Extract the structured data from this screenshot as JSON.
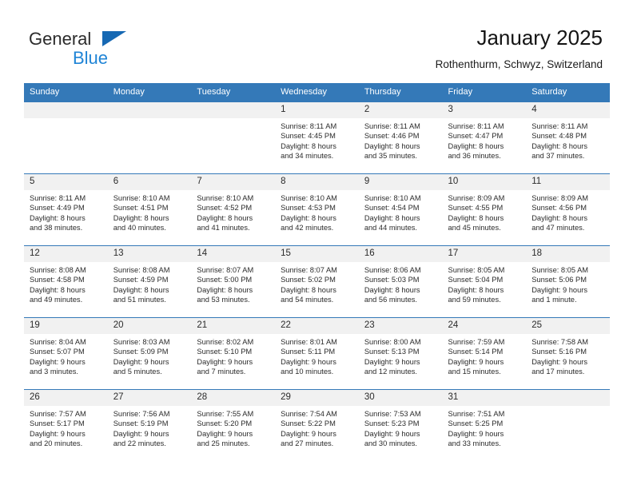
{
  "brand": {
    "name_part1": "General",
    "name_part2": "Blue",
    "accent_color": "#1668b3",
    "blue_text_color": "#1f84d6"
  },
  "header": {
    "title": "January 2025",
    "location": "Rothenthurm, Schwyz, Switzerland"
  },
  "calendar": {
    "header_bg": "#3479b8",
    "daynum_bg": "#f1f1f1",
    "weekday_labels": [
      "Sunday",
      "Monday",
      "Tuesday",
      "Wednesday",
      "Thursday",
      "Friday",
      "Saturday"
    ],
    "weeks": [
      [
        {
          "day": "",
          "lines": []
        },
        {
          "day": "",
          "lines": []
        },
        {
          "day": "",
          "lines": []
        },
        {
          "day": "1",
          "lines": [
            "Sunrise: 8:11 AM",
            "Sunset: 4:45 PM",
            "Daylight: 8 hours",
            "and 34 minutes."
          ]
        },
        {
          "day": "2",
          "lines": [
            "Sunrise: 8:11 AM",
            "Sunset: 4:46 PM",
            "Daylight: 8 hours",
            "and 35 minutes."
          ]
        },
        {
          "day": "3",
          "lines": [
            "Sunrise: 8:11 AM",
            "Sunset: 4:47 PM",
            "Daylight: 8 hours",
            "and 36 minutes."
          ]
        },
        {
          "day": "4",
          "lines": [
            "Sunrise: 8:11 AM",
            "Sunset: 4:48 PM",
            "Daylight: 8 hours",
            "and 37 minutes."
          ]
        }
      ],
      [
        {
          "day": "5",
          "lines": [
            "Sunrise: 8:11 AM",
            "Sunset: 4:49 PM",
            "Daylight: 8 hours",
            "and 38 minutes."
          ]
        },
        {
          "day": "6",
          "lines": [
            "Sunrise: 8:10 AM",
            "Sunset: 4:51 PM",
            "Daylight: 8 hours",
            "and 40 minutes."
          ]
        },
        {
          "day": "7",
          "lines": [
            "Sunrise: 8:10 AM",
            "Sunset: 4:52 PM",
            "Daylight: 8 hours",
            "and 41 minutes."
          ]
        },
        {
          "day": "8",
          "lines": [
            "Sunrise: 8:10 AM",
            "Sunset: 4:53 PM",
            "Daylight: 8 hours",
            "and 42 minutes."
          ]
        },
        {
          "day": "9",
          "lines": [
            "Sunrise: 8:10 AM",
            "Sunset: 4:54 PM",
            "Daylight: 8 hours",
            "and 44 minutes."
          ]
        },
        {
          "day": "10",
          "lines": [
            "Sunrise: 8:09 AM",
            "Sunset: 4:55 PM",
            "Daylight: 8 hours",
            "and 45 minutes."
          ]
        },
        {
          "day": "11",
          "lines": [
            "Sunrise: 8:09 AM",
            "Sunset: 4:56 PM",
            "Daylight: 8 hours",
            "and 47 minutes."
          ]
        }
      ],
      [
        {
          "day": "12",
          "lines": [
            "Sunrise: 8:08 AM",
            "Sunset: 4:58 PM",
            "Daylight: 8 hours",
            "and 49 minutes."
          ]
        },
        {
          "day": "13",
          "lines": [
            "Sunrise: 8:08 AM",
            "Sunset: 4:59 PM",
            "Daylight: 8 hours",
            "and 51 minutes."
          ]
        },
        {
          "day": "14",
          "lines": [
            "Sunrise: 8:07 AM",
            "Sunset: 5:00 PM",
            "Daylight: 8 hours",
            "and 53 minutes."
          ]
        },
        {
          "day": "15",
          "lines": [
            "Sunrise: 8:07 AM",
            "Sunset: 5:02 PM",
            "Daylight: 8 hours",
            "and 54 minutes."
          ]
        },
        {
          "day": "16",
          "lines": [
            "Sunrise: 8:06 AM",
            "Sunset: 5:03 PM",
            "Daylight: 8 hours",
            "and 56 minutes."
          ]
        },
        {
          "day": "17",
          "lines": [
            "Sunrise: 8:05 AM",
            "Sunset: 5:04 PM",
            "Daylight: 8 hours",
            "and 59 minutes."
          ]
        },
        {
          "day": "18",
          "lines": [
            "Sunrise: 8:05 AM",
            "Sunset: 5:06 PM",
            "Daylight: 9 hours",
            "and 1 minute."
          ]
        }
      ],
      [
        {
          "day": "19",
          "lines": [
            "Sunrise: 8:04 AM",
            "Sunset: 5:07 PM",
            "Daylight: 9 hours",
            "and 3 minutes."
          ]
        },
        {
          "day": "20",
          "lines": [
            "Sunrise: 8:03 AM",
            "Sunset: 5:09 PM",
            "Daylight: 9 hours",
            "and 5 minutes."
          ]
        },
        {
          "day": "21",
          "lines": [
            "Sunrise: 8:02 AM",
            "Sunset: 5:10 PM",
            "Daylight: 9 hours",
            "and 7 minutes."
          ]
        },
        {
          "day": "22",
          "lines": [
            "Sunrise: 8:01 AM",
            "Sunset: 5:11 PM",
            "Daylight: 9 hours",
            "and 10 minutes."
          ]
        },
        {
          "day": "23",
          "lines": [
            "Sunrise: 8:00 AM",
            "Sunset: 5:13 PM",
            "Daylight: 9 hours",
            "and 12 minutes."
          ]
        },
        {
          "day": "24",
          "lines": [
            "Sunrise: 7:59 AM",
            "Sunset: 5:14 PM",
            "Daylight: 9 hours",
            "and 15 minutes."
          ]
        },
        {
          "day": "25",
          "lines": [
            "Sunrise: 7:58 AM",
            "Sunset: 5:16 PM",
            "Daylight: 9 hours",
            "and 17 minutes."
          ]
        }
      ],
      [
        {
          "day": "26",
          "lines": [
            "Sunrise: 7:57 AM",
            "Sunset: 5:17 PM",
            "Daylight: 9 hours",
            "and 20 minutes."
          ]
        },
        {
          "day": "27",
          "lines": [
            "Sunrise: 7:56 AM",
            "Sunset: 5:19 PM",
            "Daylight: 9 hours",
            "and 22 minutes."
          ]
        },
        {
          "day": "28",
          "lines": [
            "Sunrise: 7:55 AM",
            "Sunset: 5:20 PM",
            "Daylight: 9 hours",
            "and 25 minutes."
          ]
        },
        {
          "day": "29",
          "lines": [
            "Sunrise: 7:54 AM",
            "Sunset: 5:22 PM",
            "Daylight: 9 hours",
            "and 27 minutes."
          ]
        },
        {
          "day": "30",
          "lines": [
            "Sunrise: 7:53 AM",
            "Sunset: 5:23 PM",
            "Daylight: 9 hours",
            "and 30 minutes."
          ]
        },
        {
          "day": "31",
          "lines": [
            "Sunrise: 7:51 AM",
            "Sunset: 5:25 PM",
            "Daylight: 9 hours",
            "and 33 minutes."
          ]
        },
        {
          "day": "",
          "lines": []
        }
      ]
    ]
  }
}
